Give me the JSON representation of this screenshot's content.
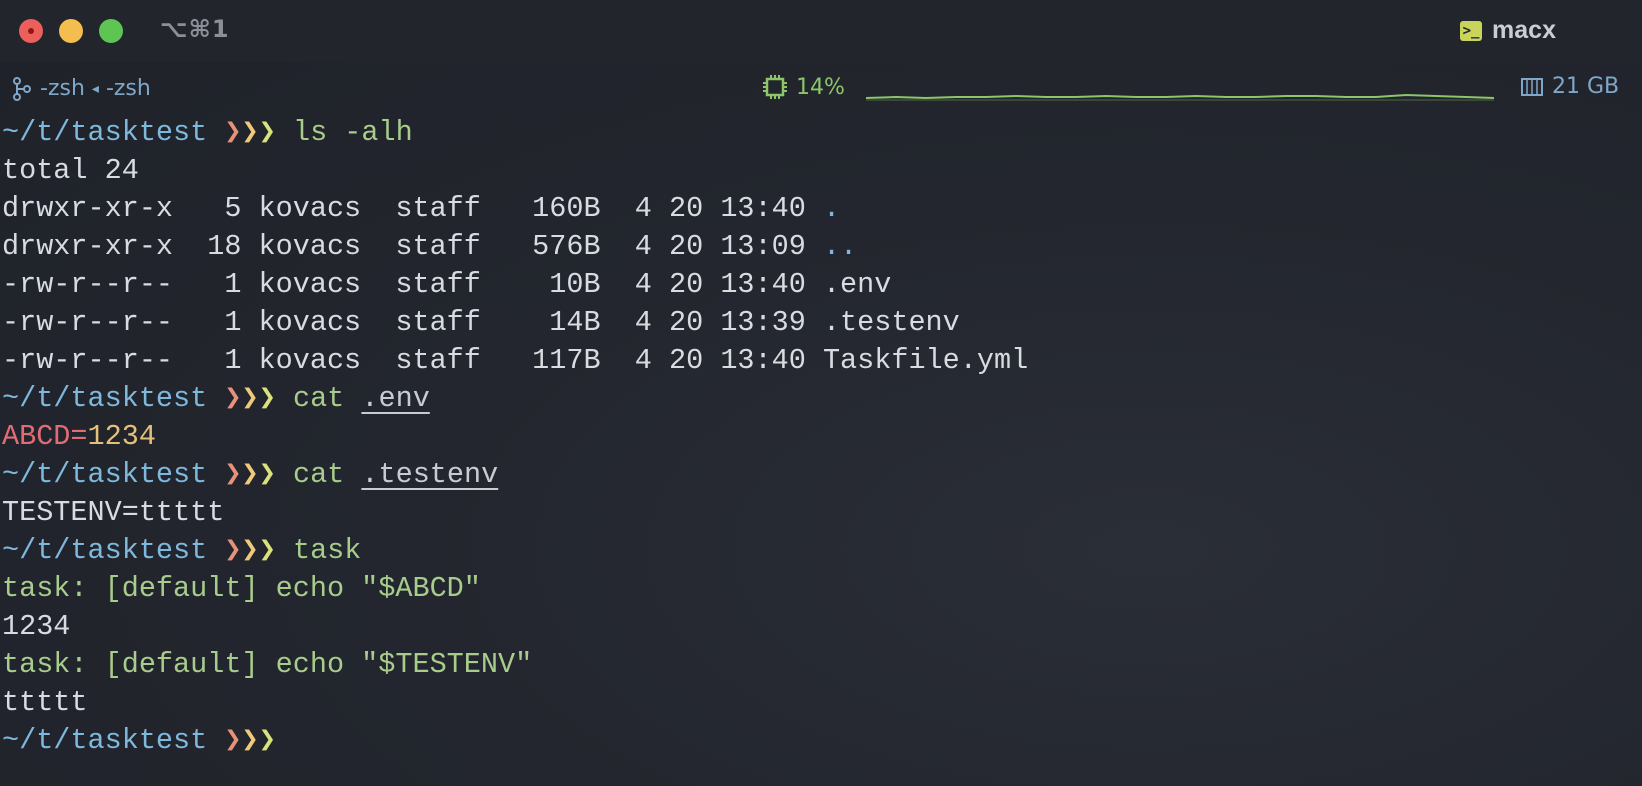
{
  "window": {
    "shortcut": "⌥⌘1",
    "host": "macx",
    "host_icon": "terminal-icon"
  },
  "status": {
    "shell1": "-zsh",
    "shell2": "-zsh",
    "cpu": "14%",
    "memory": "21 GB"
  },
  "terminal": {
    "prompt": "~/t/tasktest",
    "arrows": "❯❯❯",
    "cmd1": "ls -alh",
    "total": "total 24",
    "ls_rows": [
      {
        "perm": "drwxr-xr-x",
        "links": "5",
        "owner": "kovacs",
        "group": "staff",
        "size": "160B",
        "month": "4",
        "day": "20",
        "time": "13:40",
        "name": "."
      },
      {
        "perm": "drwxr-xr-x",
        "links": "18",
        "owner": "kovacs",
        "group": "staff",
        "size": "576B",
        "month": "4",
        "day": "20",
        "time": "13:09",
        "name": ".."
      },
      {
        "perm": "-rw-r--r--",
        "links": "1",
        "owner": "kovacs",
        "group": "staff",
        "size": "10B",
        "month": "4",
        "day": "20",
        "time": "13:40",
        "name": ".env"
      },
      {
        "perm": "-rw-r--r--",
        "links": "1",
        "owner": "kovacs",
        "group": "staff",
        "size": "14B",
        "month": "4",
        "day": "20",
        "time": "13:39",
        "name": ".testenv"
      },
      {
        "perm": "-rw-r--r--",
        "links": "1",
        "owner": "kovacs",
        "group": "staff",
        "size": "117B",
        "month": "4",
        "day": "20",
        "time": "13:40",
        "name": "Taskfile.yml"
      }
    ],
    "cmd2": "cat",
    "cmd2_arg": ".env",
    "env_key": "ABCD",
    "env_eq": "=",
    "env_val": "1234",
    "cmd3": "cat",
    "cmd3_arg": ".testenv",
    "testenv_out": "TESTENV=ttttt",
    "cmd4": "task",
    "task_line1": "task: [default] echo \"$ABCD\"",
    "task_out1": "1234",
    "task_line2": "task: [default] echo \"$TESTENV\"",
    "task_out2": "ttttt"
  },
  "colors": {
    "background": "#23262e",
    "prompt": "#7fb8dd",
    "command": "#a8cc8c",
    "cpu": "#8cc56a"
  }
}
